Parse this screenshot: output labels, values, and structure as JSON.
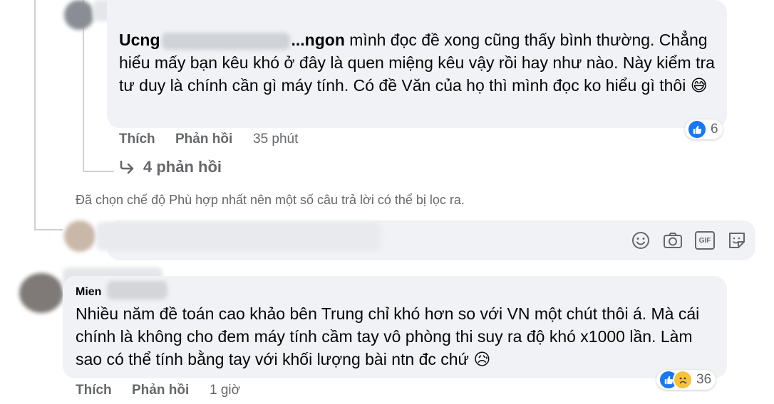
{
  "comment1": {
    "name_fragment": "Ucng",
    "name_tail": "...ngon",
    "text": "mình đọc đề xong cũng thấy bình thường. Chẳng hiểu mấy bạn kêu khó ở đây là quen miệng kêu vậy rồi hay như nào. Này kiểm tra tư duy là chính cần gì máy tính. Có đề Văn của họ thì mình đọc ko hiểu gì thôi 😅",
    "like_label": "Thích",
    "reply_label": "Phản hồi",
    "time": "35 phút",
    "reaction_count": "6",
    "reaction_types": [
      "like-icon"
    ],
    "more_replies": "4 phản hồi",
    "more_replies_icon": "reply-arrow-icon"
  },
  "filter_note": "Đã chọn chế độ Phù hợp nhất nên một số câu trả lời có thể bị lọc ra.",
  "composer": {
    "icons": [
      "emoji-icon",
      "camera-icon",
      "gif-icon",
      "sticker-icon"
    ],
    "gif_label": "GIF"
  },
  "comment2": {
    "name_fragment": "Mien",
    "text": "Nhiều năm đề toán cao khảo bên Trung chỉ khó hơn so với VN một chút thôi á. Mà cái chính là không cho đem máy tính cầm tay vô phòng thi suy ra độ khó x1000 lần. Làm sao có thể tính bằng tay với khối lượng bài ntn đc chứ 😥",
    "like_label": "Thích",
    "reply_label": "Phản hồi",
    "time": "1 giờ",
    "reaction_count": "36",
    "reaction_types": [
      "like-icon",
      "sad-icon"
    ]
  }
}
